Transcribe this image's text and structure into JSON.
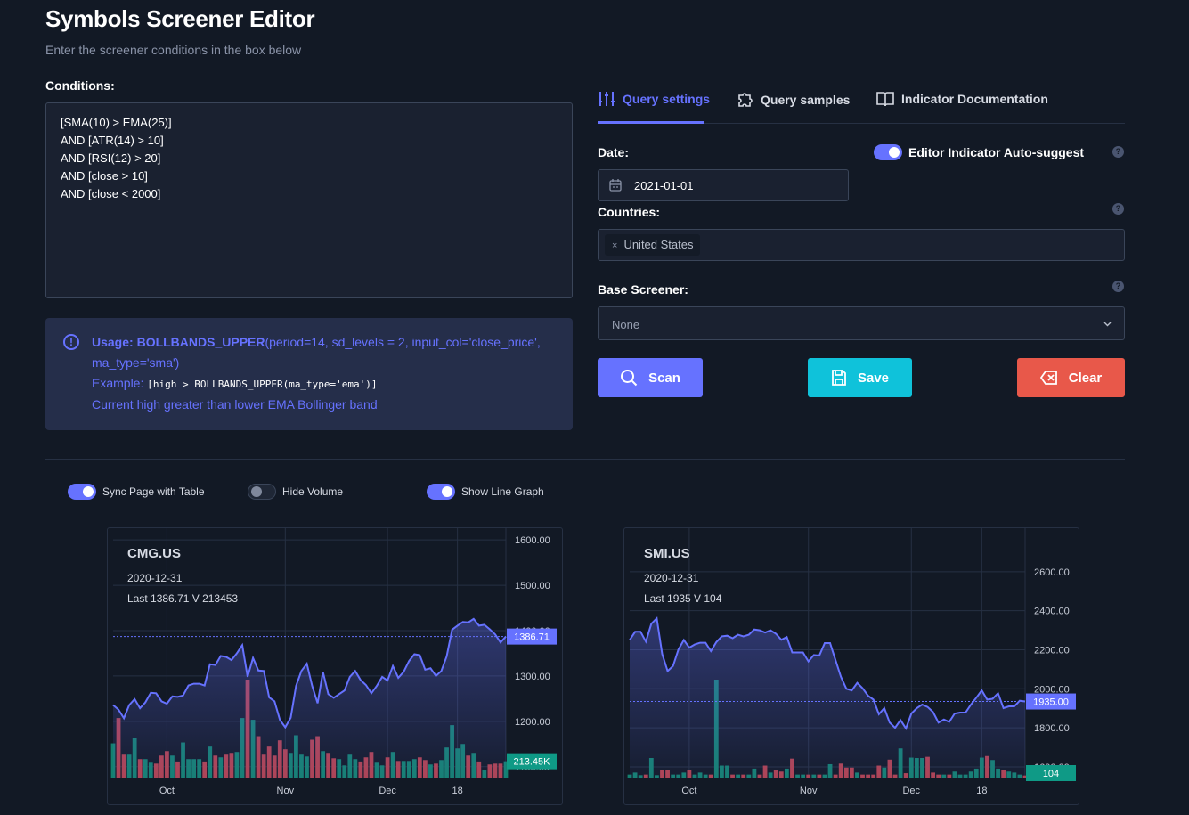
{
  "header": {
    "title": "Symbols Screener Editor",
    "subtitle": "Enter the screener conditions in the box below"
  },
  "conditions": {
    "label": "Conditions:",
    "lines": [
      "[SMA(10) > EMA(25)]",
      "AND [ATR(14) > 10]",
      "AND [RSI(12) > 20]",
      "AND [close > 10]",
      "AND [close < 2000]"
    ]
  },
  "usage": {
    "usage_label": "Usage:",
    "func": "BOLLBANDS_UPPER",
    "args": "(period=14, sd_levels = 2, input_col='close_price', ma_type='sma')",
    "example_label": "Example:",
    "example_code": "[high > BOLLBANDS_UPPER(ma_type='ema')]",
    "description": "Current high greater than lower EMA Bollinger band"
  },
  "tabs": [
    {
      "label": "Query settings",
      "icon": "sliders-icon",
      "active": true
    },
    {
      "label": "Query samples",
      "icon": "puzzle-icon"
    },
    {
      "label": "Indicator Documentation",
      "icon": "book-icon"
    }
  ],
  "settings": {
    "date_label": "Date:",
    "date_value": "2021-01-01",
    "autosuggest_label": "Editor Indicator Auto-suggest",
    "autosuggest_on": true,
    "countries_label": "Countries:",
    "countries": [
      "United States"
    ],
    "base_label": "Base Screener:",
    "base_value": "None",
    "help": "?"
  },
  "buttons": {
    "scan": "Scan",
    "save": "Save",
    "clear": "Clear"
  },
  "colors": {
    "accent": "#6672ff",
    "save": "#0fc2da",
    "clear": "#e8584a",
    "up": "#14806f",
    "down": "#b0424f"
  },
  "toggles": [
    {
      "label": "Sync Page with Table",
      "on": true
    },
    {
      "label": "Hide Volume",
      "on": false
    },
    {
      "label": "Show Line Graph",
      "on": true
    }
  ],
  "chart_data": [
    {
      "type": "line",
      "symbol": "CMG.US",
      "date": "2020-12-31",
      "info": "Last 1386.71 V 213453",
      "last_label": "1386.71",
      "volume_label": "213.45K",
      "ylim": [
        1076,
        1616
      ],
      "yticks": [
        "1600.00",
        "1500.00",
        "1400.00",
        "1300.00",
        "1200.00",
        "1100.00"
      ],
      "ytick_values": [
        1600,
        1500,
        1400,
        1300,
        1200,
        1100
      ],
      "xticks": [
        {
          "label": "Oct",
          "index": 10
        },
        {
          "label": "Nov",
          "index": 32
        },
        {
          "label": "Dec",
          "index": 51
        },
        {
          "label": "18",
          "index": 64
        }
      ],
      "close": [
        1236,
        1226,
        1207,
        1236,
        1249,
        1229,
        1242,
        1263,
        1262,
        1244,
        1239,
        1255,
        1254,
        1257,
        1279,
        1283,
        1283,
        1279,
        1326,
        1324,
        1344,
        1342,
        1335,
        1350,
        1368,
        1298,
        1340,
        1312,
        1311,
        1253,
        1244,
        1203,
        1187,
        1208,
        1278,
        1311,
        1327,
        1278,
        1240,
        1309,
        1260,
        1252,
        1260,
        1268,
        1298,
        1311,
        1291,
        1280,
        1262,
        1278,
        1298,
        1290,
        1322,
        1296,
        1309,
        1333,
        1348,
        1346,
        1314,
        1317,
        1300,
        1311,
        1343,
        1402,
        1411,
        1419,
        1418,
        1426,
        1411,
        1413,
        1403,
        1392,
        1374,
        1387
      ],
      "volume_k": [
        446,
        776,
        299,
        299,
        516,
        241,
        241,
        194,
        182,
        287,
        345,
        287,
        210,
        458,
        241,
        241,
        241,
        210,
        404,
        287,
        264,
        299,
        322,
        334,
        776,
        1276,
        753,
        539,
        299,
        404,
        287,
        485,
        369,
        322,
        551,
        299,
        275,
        493,
        539,
        345,
        322,
        252,
        241,
        159,
        299,
        241,
        210,
        264,
        334,
        194,
        159,
        264,
        334,
        217,
        217,
        217,
        241,
        264,
        229,
        171,
        182,
        229,
        392,
        683,
        380,
        438,
        287,
        322,
        210,
        101,
        171,
        182,
        182,
        213
      ]
    },
    {
      "type": "line",
      "symbol": "SMI.US",
      "date": "2020-12-31",
      "info": "Last 1935 V 104",
      "last_label": "1935.00",
      "volume_label": "104",
      "ylim": [
        1545,
        2800
      ],
      "yticks": [
        "2600.00",
        "2400.00",
        "2200.00",
        "2000.00",
        "1800.00",
        "1600.00"
      ],
      "ytick_values": [
        2600,
        2400,
        2200,
        2000,
        1800,
        1600
      ],
      "xticks": [
        {
          "label": "Oct",
          "index": 11
        },
        {
          "label": "Nov",
          "index": 33
        },
        {
          "label": "Dec",
          "index": 52
        },
        {
          "label": "18",
          "index": 65
        }
      ],
      "close": [
        2250,
        2292,
        2292,
        2242,
        2333,
        2361,
        2178,
        2091,
        2117,
        2201,
        2250,
        2211,
        2227,
        2236,
        2236,
        2193,
        2239,
        2269,
        2272,
        2259,
        2277,
        2269,
        2277,
        2304,
        2300,
        2288,
        2300,
        2282,
        2251,
        2265,
        2186,
        2186,
        2186,
        2140,
        2173,
        2170,
        2234,
        2234,
        2147,
        2061,
        2000,
        1992,
        2030,
        2003,
        1965,
        1945,
        1870,
        1901,
        1827,
        1800,
        1840,
        1797,
        1873,
        1901,
        1919,
        1907,
        1881,
        1827,
        1843,
        1830,
        1873,
        1878,
        1878,
        1919,
        1955,
        1992,
        1945,
        1949,
        1977,
        1901,
        1910,
        1910,
        1939,
        1935
      ],
      "volume": [
        150,
        250,
        120,
        150,
        980,
        120,
        400,
        400,
        150,
        150,
        250,
        400,
        150,
        250,
        150,
        150,
        4900,
        600,
        600,
        150,
        150,
        150,
        150,
        450,
        150,
        600,
        250,
        400,
        300,
        450,
        950,
        150,
        150,
        150,
        150,
        150,
        150,
        670,
        150,
        700,
        500,
        500,
        250,
        150,
        150,
        150,
        600,
        500,
        900,
        150,
        1460,
        220,
        1000,
        980,
        980,
        1040,
        250,
        150,
        150,
        150,
        300,
        150,
        150,
        300,
        450,
        1000,
        1080,
        880,
        450,
        400,
        300,
        250,
        150,
        104
      ]
    }
  ]
}
